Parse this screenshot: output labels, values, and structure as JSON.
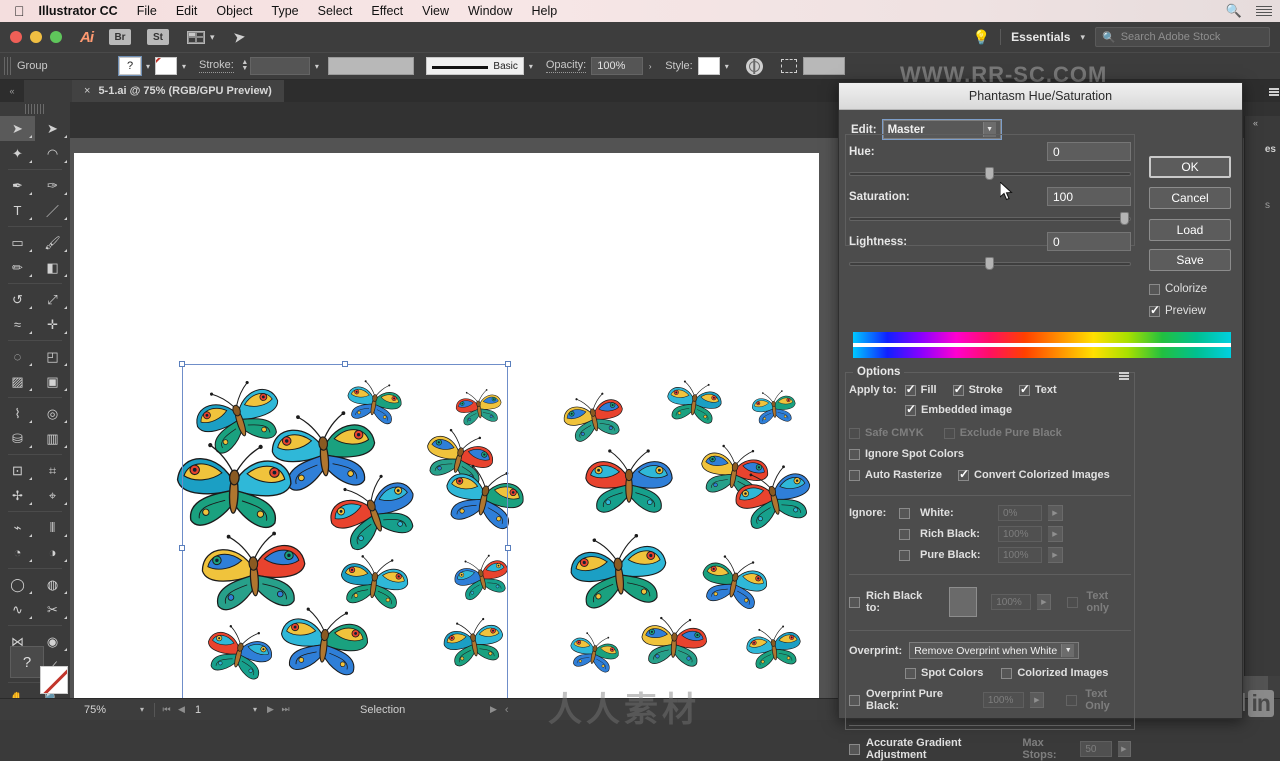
{
  "macmenu": {
    "apple_icon": "apple-icon",
    "app_name": "Illustrator CC",
    "items": [
      "File",
      "Edit",
      "Object",
      "Type",
      "Select",
      "Effect",
      "View",
      "Window",
      "Help"
    ],
    "search_icon": "search-icon",
    "menu_icon": "list-menu-icon"
  },
  "apptitle": {
    "app_badge": "Ai",
    "bridge_label": "Br",
    "stock_label": "St",
    "arrange_icon": "arrange-documents-icon",
    "behance_icon": "behance-share-icon",
    "bulb_icon": "stock-bulb-icon",
    "workspace": "Essentials",
    "workspace_caret": "chevron-down-icon",
    "search_placeholder": "Search Adobe Stock",
    "search_icon": "search-icon"
  },
  "controlbar": {
    "selection_label": "Group",
    "fill_swatch": "?",
    "fill_caret": "chevron-down-icon",
    "stroke_swatch": "none-swatch-icon",
    "stroke_caret": "chevron-down-icon",
    "stroke_label": "Stroke:",
    "stroke_weight": "",
    "stroke_weight_caret": "chevron-down-icon",
    "variable_width": "",
    "brush_label": "Basic",
    "brush_caret": "chevron-down-icon",
    "opacity_label": "Opacity:",
    "opacity_value": "100%",
    "opacity_arrow": ">",
    "style_label": "Style:",
    "style_caret": "chevron-down-icon",
    "recolor_icon": "recolor-artwork-icon",
    "transform_icon": "transform-selection-icon"
  },
  "tabstrip": {
    "collapse_icon": "collapse-panel-icon",
    "tab_close": "×",
    "tab_title": "5-1.ai @ 75% (RGB/GPU Preview)"
  },
  "toolbox": {
    "tools": [
      {
        "name": "selection-tool",
        "glyph": "selection-arrow"
      },
      {
        "name": "direct-selection-tool",
        "glyph": "direct-arrow"
      },
      {
        "name": "magic-wand-tool",
        "glyph": "wand"
      },
      {
        "name": "lasso-tool",
        "glyph": "lasso"
      },
      {
        "name": "pen-tool",
        "glyph": "pen"
      },
      {
        "name": "curvature-tool",
        "glyph": "curvature"
      },
      {
        "name": "type-tool",
        "glyph": "T"
      },
      {
        "name": "line-segment-tool",
        "glyph": "line"
      },
      {
        "name": "rectangle-tool",
        "glyph": "rectangle"
      },
      {
        "name": "paintbrush-tool",
        "glyph": "brush"
      },
      {
        "name": "pencil-tool",
        "glyph": "pencil"
      },
      {
        "name": "eraser-tool",
        "glyph": "eraser"
      },
      {
        "name": "rotate-tool",
        "glyph": "rotate"
      },
      {
        "name": "scale-tool",
        "glyph": "scale"
      },
      {
        "name": "width-tool",
        "glyph": "width"
      },
      {
        "name": "free-transform-tool",
        "glyph": "free-transform"
      },
      {
        "name": "shape-builder-tool",
        "glyph": "shape-builder"
      },
      {
        "name": "perspective-grid-tool",
        "glyph": "perspective"
      },
      {
        "name": "mesh-tool",
        "glyph": "mesh"
      },
      {
        "name": "gradient-tool",
        "glyph": "gradient"
      },
      {
        "name": "eyedropper-tool",
        "glyph": "eyedropper"
      },
      {
        "name": "blend-tool",
        "glyph": "blend"
      },
      {
        "name": "symbol-sprayer-tool",
        "glyph": "sprayer"
      },
      {
        "name": "column-graph-tool",
        "glyph": "graph"
      },
      {
        "name": "artboard-tool",
        "glyph": "artboard"
      },
      {
        "name": "slice-tool",
        "glyph": "slice"
      },
      {
        "name": "free-transform-2-tool",
        "glyph": "transform2"
      },
      {
        "name": "puppet-warp-tool",
        "glyph": "puppet"
      },
      {
        "name": "measure-tool",
        "glyph": "measure"
      },
      {
        "name": "ruler-tool",
        "glyph": "ruler"
      },
      {
        "name": "live-paint-bucket-tool",
        "glyph": "paint-bucket"
      },
      {
        "name": "live-paint-selection-tool",
        "glyph": "paint-select"
      },
      {
        "name": "shape-builder-2-tool",
        "glyph": "shape2"
      },
      {
        "name": "blend-2-tool",
        "glyph": "blend2"
      },
      {
        "name": "reshape-tool",
        "glyph": "reshape"
      },
      {
        "name": "scissors-tool",
        "glyph": "scissors"
      },
      {
        "name": "symbol-shifter-tool",
        "glyph": "butterfly"
      },
      {
        "name": "rotate-view-tool",
        "glyph": "rotate-view"
      },
      {
        "name": "crop-image-tool",
        "glyph": "crop"
      },
      {
        "name": "knife-tool",
        "glyph": "knife"
      },
      {
        "name": "hand-tool",
        "glyph": "hand"
      },
      {
        "name": "zoom-tool",
        "glyph": "magnifier"
      }
    ],
    "help_label": "?",
    "fill_stroke": "fill-stroke-indicator"
  },
  "statusbar": {
    "zoom": "75%",
    "zoom_caret": "chevron-down-icon",
    "first_page_icon": "first-page-icon",
    "prev_page_icon": "prev-page-icon",
    "page": "1",
    "page_caret": "chevron-down-icon",
    "next_page_icon": "next-page-icon",
    "last_page_icon": "last-page-icon",
    "status_text": "Selection",
    "status_arrow": "▶",
    "resize_grip": "‹"
  },
  "dialog": {
    "title": "Phantasm Hue/Saturation",
    "edit_label": "Edit:",
    "edit_value": "Master",
    "edit_caret": "chevron-down-icon",
    "sliders": [
      {
        "label": "Hue:",
        "value": "0",
        "knob_pct": 50
      },
      {
        "label": "Saturation:",
        "value": "100",
        "knob_pct": 98
      },
      {
        "label": "Lightness:",
        "value": "0",
        "knob_pct": 50
      }
    ],
    "buttons": [
      {
        "label": "OK",
        "primary": true
      },
      {
        "label": "Cancel",
        "primary": false
      },
      {
        "label": "Load",
        "primary": false
      },
      {
        "label": "Save",
        "primary": false
      }
    ],
    "colorize": {
      "label": "Colorize",
      "checked": false
    },
    "preview": {
      "label": "Preview",
      "checked": true
    },
    "hue_bar_icon": "hue-spectrum-bar",
    "options": {
      "title": "Options",
      "menu_icon": "panel-menu-icon",
      "apply_to_label": "Apply to:",
      "apply_to": [
        {
          "label": "Fill",
          "checked": true,
          "disabled": false
        },
        {
          "label": "Stroke",
          "checked": true,
          "disabled": false
        },
        {
          "label": "Text",
          "checked": true,
          "disabled": false
        }
      ],
      "embedded_image": {
        "label": "Embedded image",
        "checked": true,
        "disabled": false
      },
      "safe_cmyk": {
        "label": "Safe CMYK",
        "checked": false,
        "disabled": true
      },
      "exclude_pure_black": {
        "label": "Exclude Pure Black",
        "checked": false,
        "disabled": true
      },
      "ignore_spot_colors": {
        "label": "Ignore Spot Colors",
        "checked": false,
        "disabled": false
      },
      "auto_rasterize": {
        "label": "Auto Rasterize",
        "checked": false,
        "disabled": false
      },
      "convert_colorized_images": {
        "label": "Convert Colorized Images",
        "checked": true,
        "disabled": false
      },
      "ignore_label": "Ignore:",
      "ignore_rows": [
        {
          "label": "White:",
          "value": "0%",
          "checked": false
        },
        {
          "label": "Rich Black:",
          "value": "100%",
          "checked": false
        },
        {
          "label": "Pure Black:",
          "value": "100%",
          "checked": false
        }
      ],
      "rich_black_to": {
        "label": "Rich Black to:",
        "checked": false,
        "value": "100%",
        "swatch": "rich-black-swatch"
      },
      "rich_black_text_only": {
        "label": "Text only",
        "checked": false
      },
      "overprint_label": "Overprint:",
      "overprint_value": "Remove Overprint when White",
      "overprint_caret": "chevron-down-icon",
      "overprint_spot_colors": {
        "label": "Spot Colors",
        "checked": false
      },
      "overprint_colorized_images": {
        "label": "Colorized Images",
        "checked": false
      },
      "overprint_pure_black": {
        "label": "Overprint Pure Black:",
        "checked": false,
        "value": "100%"
      },
      "overprint_text_only": {
        "label": "Text Only",
        "checked": false
      },
      "accurate_gradient": {
        "label": "Accurate Gradient Adjustment",
        "checked": false
      },
      "max_stops_label": "Max Stops:",
      "max_stops_value": "50"
    }
  },
  "canvas": {
    "document_name": "5-1.ai",
    "selection_handles": 8,
    "artwork_description": "butterflies-illustration-group"
  },
  "watermarks": {
    "center": "人人素材",
    "top": "WWW.RR-SC.COM",
    "linkedin_text": "Linked",
    "linkedin_badge": "in"
  },
  "colors": {
    "accent_blue": "#6f8ec9",
    "dialog_bg": "#4c4c4c",
    "chrome_bg": "#3d3d3d",
    "canvas_bg": "#535353"
  }
}
